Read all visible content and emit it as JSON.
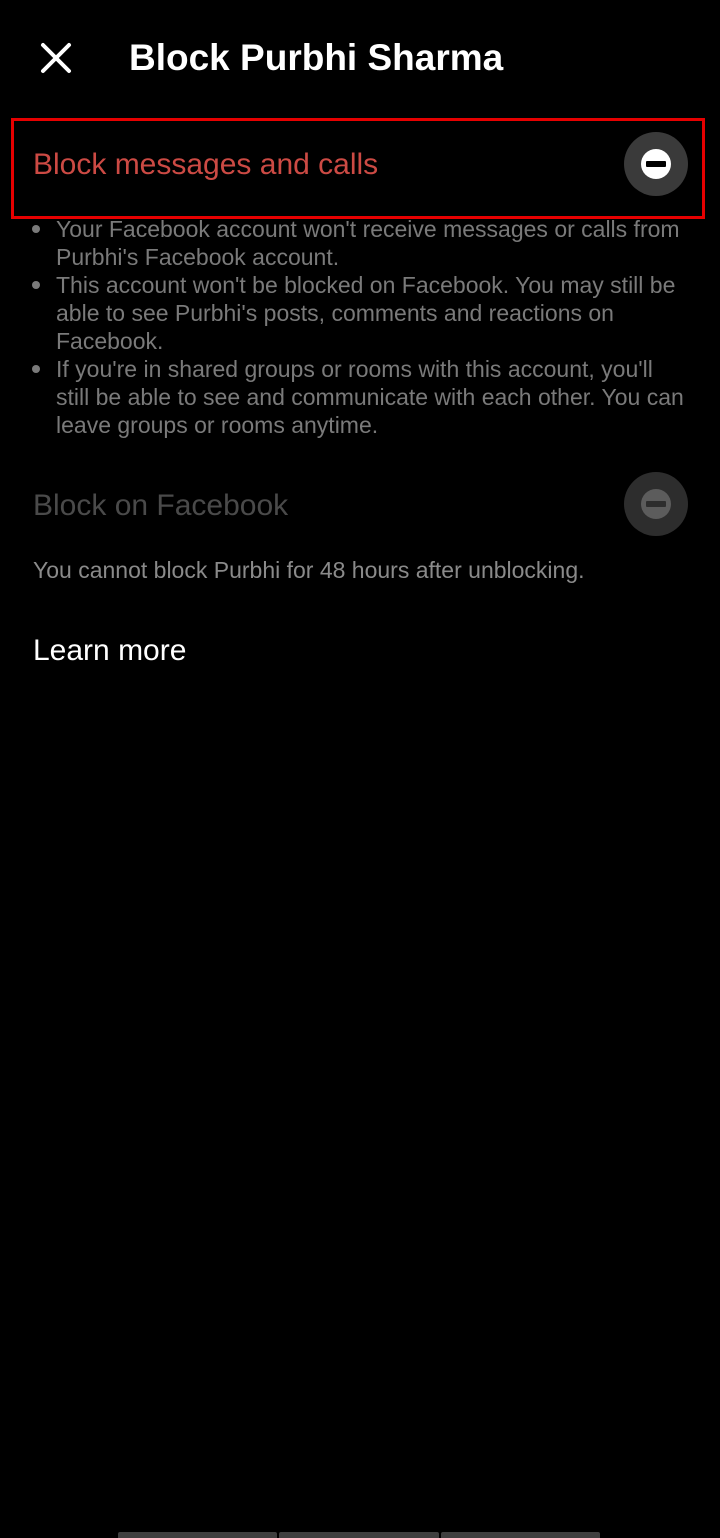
{
  "header": {
    "title": "Block Purbhi Sharma",
    "close_icon": "close-icon"
  },
  "block_messages": {
    "label": "Block messages and calls",
    "state": "active",
    "icon": "block-icon",
    "label_color": "#cc4a44",
    "highlight_color": "#e60000"
  },
  "bullets": [
    "Your Facebook account won't receive messages or calls from Purbhi's Facebook account.",
    "This account won't be blocked on Facebook. You may still be able to see Purbhi's posts, comments and reactions on Facebook.",
    "If you're in shared groups or rooms with this account, you'll still be able to see and communicate with each other. You can leave groups or rooms anytime."
  ],
  "block_facebook": {
    "label": "Block on Facebook",
    "state": "disabled",
    "icon": "block-icon",
    "note": "You cannot block Purbhi for 48 hours after unblocking."
  },
  "learn_more": {
    "label": "Learn more"
  },
  "colors": {
    "background": "#000000",
    "text_primary": "#ffffff",
    "text_secondary": "#7a7a7a"
  }
}
